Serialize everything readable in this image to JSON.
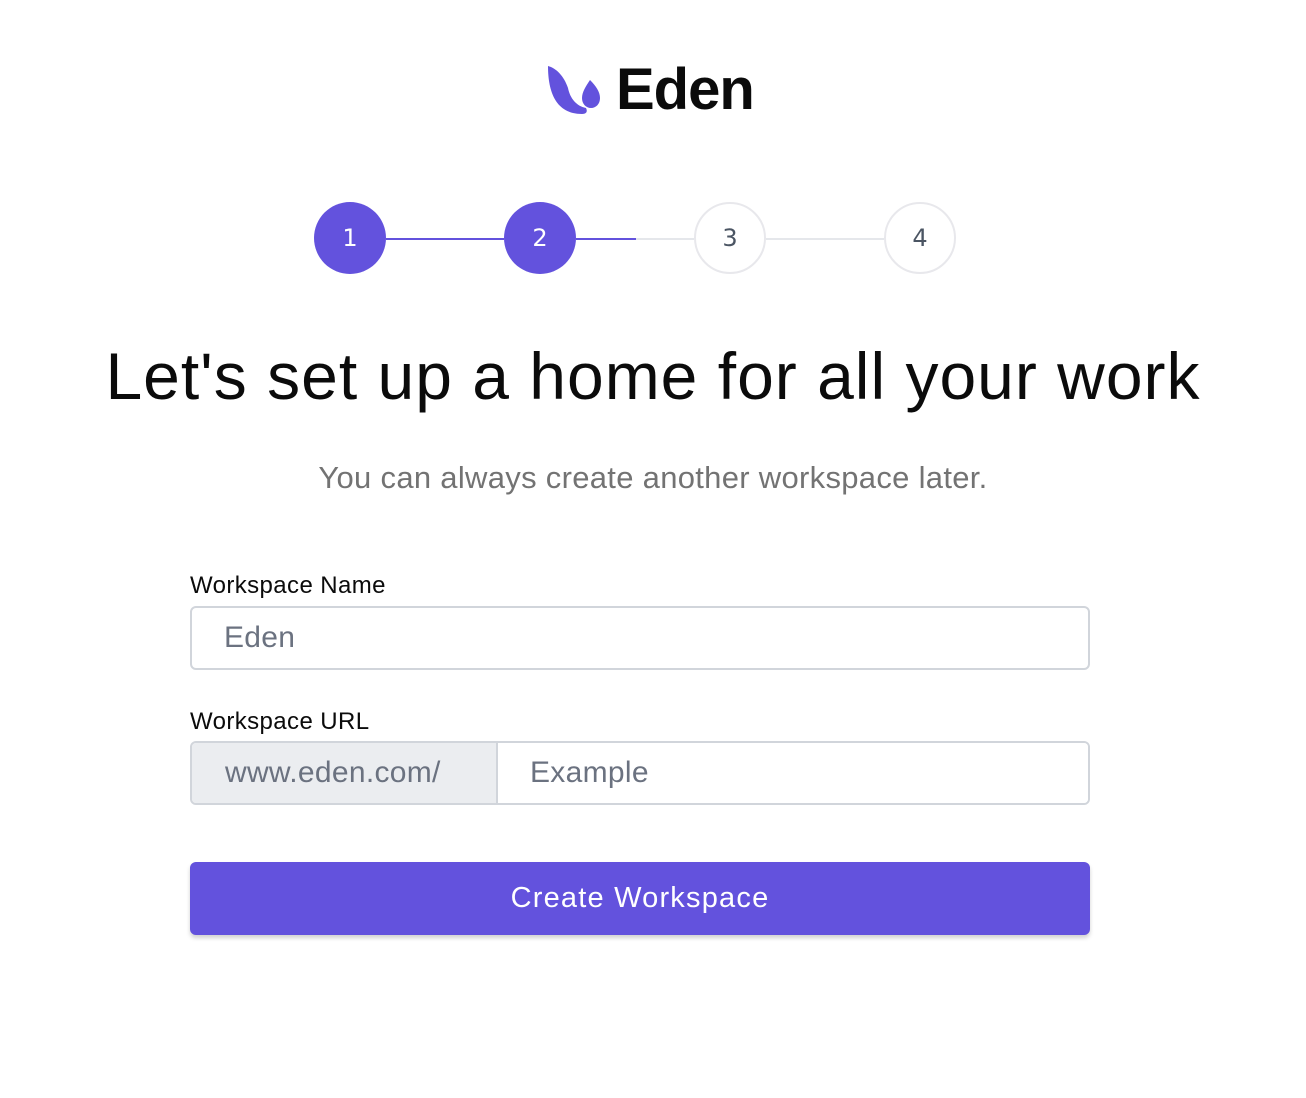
{
  "brand": {
    "name": "Eden",
    "logo_icon": "leaf-drop-logo-icon",
    "accent_color": "#6352dd"
  },
  "stepper": {
    "current_step": 2,
    "steps": [
      {
        "label": "1",
        "state": "complete"
      },
      {
        "label": "2",
        "state": "current"
      },
      {
        "label": "3",
        "state": "upcoming"
      },
      {
        "label": "4",
        "state": "upcoming"
      }
    ]
  },
  "heading": {
    "title": "Let's set up a home for all your work",
    "subtitle": "You can always create another workspace later."
  },
  "form": {
    "workspace_name": {
      "label": "Workspace Name",
      "placeholder": "Eden",
      "value": ""
    },
    "workspace_url": {
      "label": "Workspace URL",
      "prefix": "www.eden.com/",
      "placeholder": "Example",
      "value": ""
    },
    "submit_label": "Create Workspace"
  }
}
